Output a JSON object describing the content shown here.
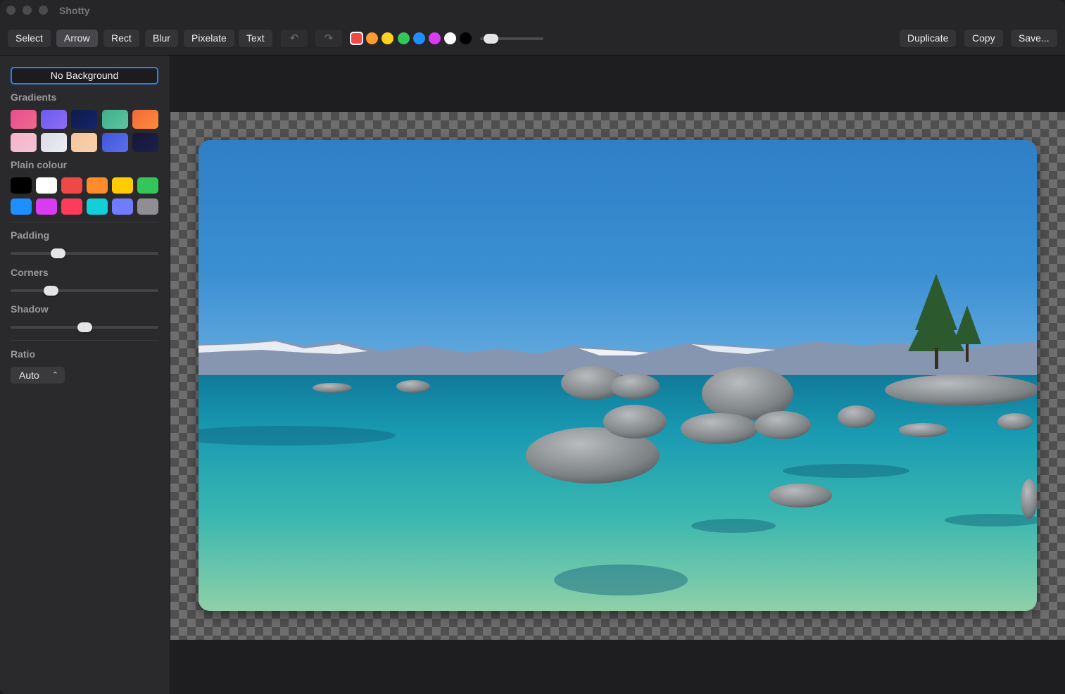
{
  "app": {
    "title": "Shotty"
  },
  "toolbar": {
    "tools": [
      "Select",
      "Arrow",
      "Rect",
      "Blur",
      "Pixelate",
      "Text"
    ],
    "active_tool": "Arrow",
    "undo_icon": "undo-icon",
    "redo_icon": "redo-icon",
    "colors": [
      "#f04747",
      "#ff9a2e",
      "#ffd21f",
      "#33c759",
      "#1e8fff",
      "#d93cf0",
      "#ffffff",
      "#000000"
    ],
    "selected_color": "#f04747",
    "stroke_level": 0.17,
    "duplicate_label": "Duplicate",
    "copy_label": "Copy",
    "save_label": "Save..."
  },
  "sidebar": {
    "no_background_label": "No Background",
    "gradients_label": "Gradients",
    "gradients": [
      [
        "#e94e8d",
        "#f0688f"
      ],
      [
        "#6a5cf5",
        "#8f6cf0"
      ],
      [
        "#0e1a4d",
        "#16256b"
      ],
      [
        "#3fae8e",
        "#5fc49e"
      ],
      [
        "#f06a3a",
        "#ff8a3c"
      ],
      [
        "#f7b3c9",
        "#f3c2d3"
      ],
      [
        "#d9dbe6",
        "#eceef4"
      ],
      [
        "#f6c49a",
        "#f9d1ad"
      ],
      [
        "#3f57d8",
        "#5d6ef0"
      ],
      [
        "#141638",
        "#1d1f4a"
      ]
    ],
    "plain_label": "Plain colour",
    "plain_colors": [
      "#000000",
      "#ffffff",
      "#f04747",
      "#ff8c2a",
      "#ffcc00",
      "#33c759",
      "#1e8fff",
      "#d93cf0",
      "#ff3b5c",
      "#12cfd8",
      "#6f7cff",
      "#8e8e93"
    ],
    "padding_label": "Padding",
    "padding_level": 0.32,
    "corners_label": "Corners",
    "corners_level": 0.27,
    "shadow_label": "Shadow",
    "shadow_level": 0.5,
    "ratio_label": "Ratio",
    "ratio_value": "Auto",
    "ratio_icon": "chevron-updown-icon"
  },
  "canvas": {
    "background": "transparent-checkerboard",
    "image": "lake-with-boulders-photo"
  }
}
